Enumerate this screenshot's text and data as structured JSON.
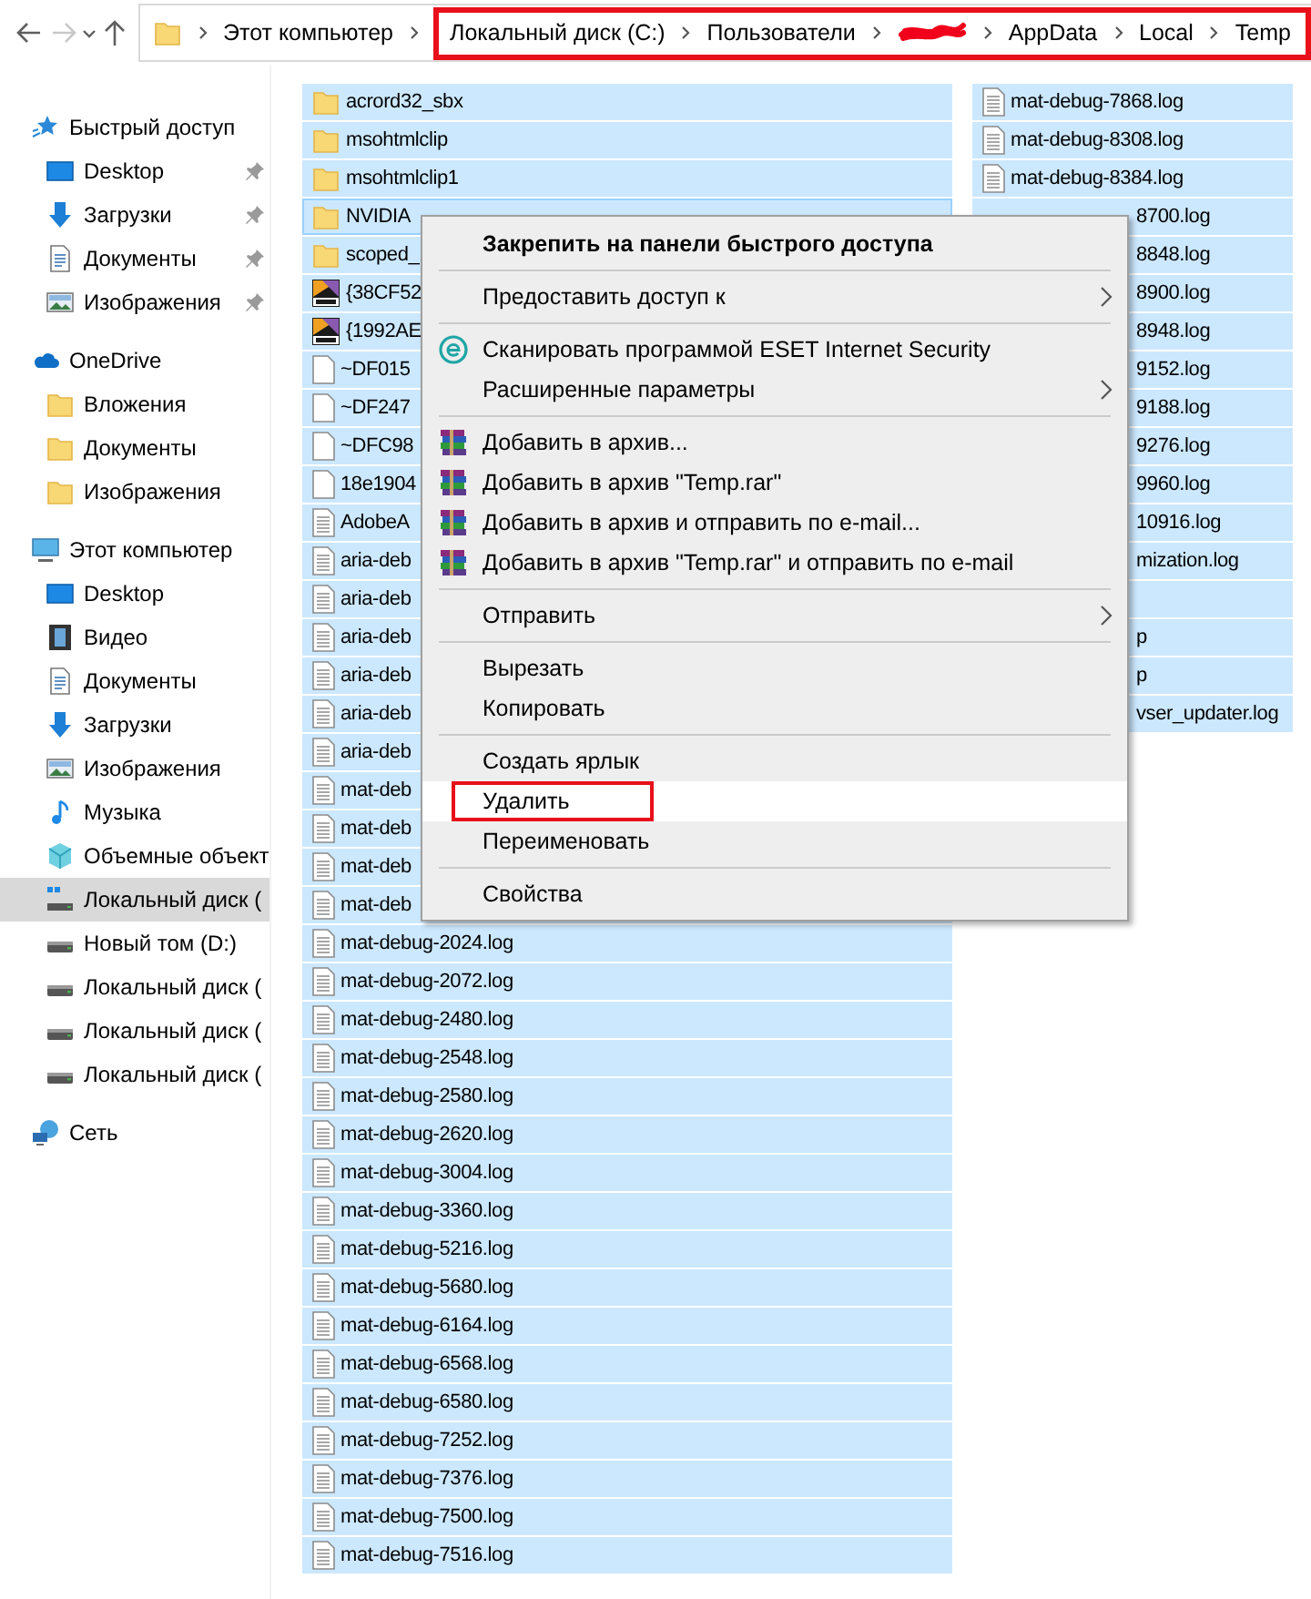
{
  "nav": {
    "buttons": [
      {
        "kind": "back",
        "disabled": false
      },
      {
        "kind": "forward",
        "disabled": true
      },
      {
        "kind": "recent",
        "disabled": false
      },
      {
        "kind": "up",
        "disabled": false
      }
    ]
  },
  "address": {
    "crumbs": [
      {
        "kind": "folder"
      },
      {
        "kind": "text",
        "label": "Этот компьютер"
      }
    ],
    "highlight_frame": {
      "crumbs": [
        {
          "kind": "text",
          "label": "Локальный диск (C:)"
        },
        {
          "kind": "text",
          "label": "Пользователи"
        },
        {
          "kind": "redacted"
        },
        {
          "kind": "text",
          "label": "AppData"
        },
        {
          "kind": "text",
          "label": "Local"
        },
        {
          "kind": "text",
          "label": "Temp"
        }
      ]
    }
  },
  "sidebar": {
    "sections": [
      {
        "label": "Быстрый доступ",
        "kind": "star",
        "selected": false,
        "children": [
          {
            "label": "Desktop",
            "kind": "desktop",
            "pinned": true,
            "selected": false
          },
          {
            "label": "Загрузки",
            "kind": "download",
            "pinned": true,
            "selected": false
          },
          {
            "label": "Документы",
            "kind": "document",
            "pinned": true,
            "selected": false
          },
          {
            "label": "Изображения",
            "kind": "image",
            "pinned": true,
            "selected": false
          }
        ]
      },
      {
        "label": "OneDrive",
        "kind": "cloud",
        "selected": false,
        "children": [
          {
            "label": "Вложения",
            "kind": "folder",
            "pinned": false,
            "selected": false
          },
          {
            "label": "Документы",
            "kind": "folder",
            "pinned": false,
            "selected": false
          },
          {
            "label": "Изображения",
            "kind": "folder",
            "pinned": false,
            "selected": false
          }
        ]
      },
      {
        "label": "Этот компьютер",
        "kind": "computer",
        "selected": false,
        "children": [
          {
            "label": "Desktop",
            "kind": "desktop",
            "pinned": false,
            "selected": false
          },
          {
            "label": "Видео",
            "kind": "video",
            "pinned": false,
            "selected": false
          },
          {
            "label": "Документы",
            "kind": "document",
            "pinned": false,
            "selected": false
          },
          {
            "label": "Загрузки",
            "kind": "download",
            "pinned": false,
            "selected": false
          },
          {
            "label": "Изображения",
            "kind": "image",
            "pinned": false,
            "selected": false
          },
          {
            "label": "Музыка",
            "kind": "music",
            "pinned": false,
            "selected": false
          },
          {
            "label": "Объемные объект",
            "kind": "cube",
            "pinned": false,
            "selected": false
          },
          {
            "label": "Локальный диск (",
            "kind": "system-drive",
            "pinned": false,
            "selected": true
          },
          {
            "label": "Новый том (D:)",
            "kind": "drive",
            "pinned": false,
            "selected": false
          },
          {
            "label": "Локальный диск (",
            "kind": "drive",
            "pinned": false,
            "selected": false
          },
          {
            "label": "Локальный диск (",
            "kind": "drive",
            "pinned": false,
            "selected": false
          },
          {
            "label": "Локальный диск (",
            "kind": "drive",
            "pinned": false,
            "selected": false
          }
        ]
      },
      {
        "label": "Сеть",
        "kind": "network",
        "selected": false
      }
    ]
  },
  "files": {
    "columns": [
      {
        "rows": [
          {
            "name": "acrord32_sbx",
            "kind": "folder",
            "selected": true,
            "focused": false
          },
          {
            "name": "msohtmlclip",
            "kind": "folder",
            "selected": true,
            "focused": false
          },
          {
            "name": "msohtmlclip1",
            "kind": "folder",
            "selected": true,
            "focused": false
          },
          {
            "name": "NVIDIA",
            "kind": "folder",
            "selected": true,
            "focused": true
          },
          {
            "name": "scoped_",
            "kind": "folder",
            "selected": true,
            "focused": false
          },
          {
            "name": "{38CF52",
            "kind": "dat",
            "selected": true,
            "focused": false
          },
          {
            "name": "{1992AE",
            "kind": "dat",
            "selected": true,
            "focused": false
          },
          {
            "name": "~DF015",
            "kind": "blank",
            "selected": true,
            "focused": false
          },
          {
            "name": "~DF247",
            "kind": "blank",
            "selected": true,
            "focused": false
          },
          {
            "name": "~DFC98",
            "kind": "blank",
            "selected": true,
            "focused": false
          },
          {
            "name": "18e1904",
            "kind": "blank",
            "selected": true,
            "focused": false
          },
          {
            "name": "AdobeA",
            "kind": "text",
            "selected": true,
            "focused": false
          },
          {
            "name": "aria-deb",
            "kind": "text",
            "selected": true,
            "focused": false
          },
          {
            "name": "aria-deb",
            "kind": "text",
            "selected": true,
            "focused": false
          },
          {
            "name": "aria-deb",
            "kind": "text",
            "selected": true,
            "focused": false
          },
          {
            "name": "aria-deb",
            "kind": "text",
            "selected": true,
            "focused": false
          },
          {
            "name": "aria-deb",
            "kind": "text",
            "selected": true,
            "focused": false
          },
          {
            "name": "aria-deb",
            "kind": "text",
            "selected": true,
            "focused": false
          },
          {
            "name": "mat-deb",
            "kind": "text",
            "selected": true,
            "focused": false
          },
          {
            "name": "mat-deb",
            "kind": "text",
            "selected": true,
            "focused": false
          },
          {
            "name": "mat-deb",
            "kind": "text",
            "selected": true,
            "focused": false
          },
          {
            "name": "mat-deb",
            "kind": "text",
            "selected": true,
            "focused": false
          },
          {
            "name": "mat-debug-2024.log",
            "kind": "text",
            "selected": true,
            "focused": false
          },
          {
            "name": "mat-debug-2072.log",
            "kind": "text",
            "selected": true,
            "focused": false
          },
          {
            "name": "mat-debug-2480.log",
            "kind": "text",
            "selected": true,
            "focused": false
          },
          {
            "name": "mat-debug-2548.log",
            "kind": "text",
            "selected": true,
            "focused": false
          },
          {
            "name": "mat-debug-2580.log",
            "kind": "text",
            "selected": true,
            "focused": false
          },
          {
            "name": "mat-debug-2620.log",
            "kind": "text",
            "selected": true,
            "focused": false
          },
          {
            "name": "mat-debug-3004.log",
            "kind": "text",
            "selected": true,
            "focused": false
          },
          {
            "name": "mat-debug-3360.log",
            "kind": "text",
            "selected": true,
            "focused": false
          },
          {
            "name": "mat-debug-5216.log",
            "kind": "text",
            "selected": true,
            "focused": false
          },
          {
            "name": "mat-debug-5680.log",
            "kind": "text",
            "selected": true,
            "focused": false
          },
          {
            "name": "mat-debug-6164.log",
            "kind": "text",
            "selected": true,
            "focused": false
          },
          {
            "name": "mat-debug-6568.log",
            "kind": "text",
            "selected": true,
            "focused": false
          },
          {
            "name": "mat-debug-6580.log",
            "kind": "text",
            "selected": true,
            "focused": false
          },
          {
            "name": "mat-debug-7252.log",
            "kind": "text",
            "selected": true,
            "focused": false
          },
          {
            "name": "mat-debug-7376.log",
            "kind": "text",
            "selected": true,
            "focused": false
          },
          {
            "name": "mat-debug-7500.log",
            "kind": "text",
            "selected": true,
            "focused": false
          },
          {
            "name": "mat-debug-7516.log",
            "kind": "text",
            "selected": true,
            "focused": false
          }
        ]
      },
      {
        "rows": [
          {
            "name": "mat-debug-7868.log",
            "kind": "text",
            "selected": true,
            "focused": false
          },
          {
            "name": "mat-debug-8308.log",
            "kind": "text",
            "selected": true,
            "focused": false
          },
          {
            "name": "mat-debug-8384.log",
            "kind": "text",
            "selected": true,
            "focused": false
          },
          {
            "name": "8700.log",
            "kind": "hidden",
            "selected": true,
            "focused": false
          },
          {
            "name": "8848.log",
            "kind": "hidden",
            "selected": true,
            "focused": false
          },
          {
            "name": "8900.log",
            "kind": "hidden",
            "selected": true,
            "focused": false
          },
          {
            "name": "8948.log",
            "kind": "hidden",
            "selected": true,
            "focused": false
          },
          {
            "name": "9152.log",
            "kind": "hidden",
            "selected": true,
            "focused": false
          },
          {
            "name": "9188.log",
            "kind": "hidden",
            "selected": true,
            "focused": false
          },
          {
            "name": "9276.log",
            "kind": "hidden",
            "selected": true,
            "focused": false
          },
          {
            "name": "9960.log",
            "kind": "hidden",
            "selected": true,
            "focused": false
          },
          {
            "name": "10916.log",
            "kind": "hidden",
            "selected": true,
            "focused": false
          },
          {
            "name": "mization.log",
            "kind": "hidden",
            "selected": true,
            "focused": false
          },
          {
            "kind": "hidden",
            "selected": true,
            "focused": false
          },
          {
            "name": "p",
            "kind": "hidden",
            "selected": true,
            "focused": false
          },
          {
            "name": "p",
            "kind": "hidden",
            "selected": true,
            "focused": false
          },
          {
            "name": "vser_updater.log",
            "kind": "hidden",
            "selected": true,
            "focused": false
          }
        ]
      }
    ]
  },
  "context_menu": {
    "items": [
      {
        "kind": "item",
        "label": "Закрепить на панели быстрого доступа",
        "bold": true,
        "submenu": false,
        "hovered": false,
        "marked": false
      },
      {
        "kind": "separator"
      },
      {
        "kind": "item",
        "label": "Предоставить доступ к",
        "bold": false,
        "submenu": true,
        "hovered": false,
        "marked": false
      },
      {
        "kind": "separator"
      },
      {
        "kind": "eset-item",
        "label": "Сканировать программой ESET Internet Security",
        "bold": false,
        "submenu": false,
        "hovered": false,
        "marked": false
      },
      {
        "kind": "item",
        "label": "Расширенные параметры",
        "bold": false,
        "submenu": true,
        "hovered": false,
        "marked": false
      },
      {
        "kind": "separator"
      },
      {
        "kind": "archive-item",
        "label": "Добавить в архив...",
        "bold": false,
        "submenu": false,
        "hovered": false,
        "marked": false
      },
      {
        "kind": "archive-item",
        "label": "Добавить в архив \"Temp.rar\"",
        "bold": false,
        "submenu": false,
        "hovered": false,
        "marked": false
      },
      {
        "kind": "archive-item",
        "label": "Добавить в архив и отправить по e-mail...",
        "bold": false,
        "submenu": false,
        "hovered": false,
        "marked": false
      },
      {
        "kind": "archive-item",
        "label": "Добавить в архив \"Temp.rar\" и отправить по e-mail",
        "bold": false,
        "submenu": false,
        "hovered": false,
        "marked": false
      },
      {
        "kind": "separator"
      },
      {
        "kind": "item",
        "label": "Отправить",
        "bold": false,
        "submenu": true,
        "hovered": false,
        "marked": false
      },
      {
        "kind": "separator"
      },
      {
        "kind": "item",
        "label": "Вырезать",
        "bold": false,
        "submenu": false,
        "hovered": false,
        "marked": false
      },
      {
        "kind": "item",
        "label": "Копировать",
        "bold": false,
        "submenu": false,
        "hovered": false,
        "marked": false
      },
      {
        "kind": "separator"
      },
      {
        "kind": "item",
        "label": "Создать ярлык",
        "bold": false,
        "submenu": false,
        "hovered": false,
        "marked": false
      },
      {
        "kind": "item",
        "label": "Удалить",
        "bold": false,
        "submenu": false,
        "hovered": true,
        "marked": true
      },
      {
        "kind": "item",
        "label": "Переименовать",
        "bold": false,
        "submenu": false,
        "hovered": false,
        "marked": false
      },
      {
        "kind": "separator"
      },
      {
        "kind": "item",
        "label": "Свойства",
        "bold": false,
        "submenu": false,
        "hovered": false,
        "marked": false
      }
    ]
  }
}
